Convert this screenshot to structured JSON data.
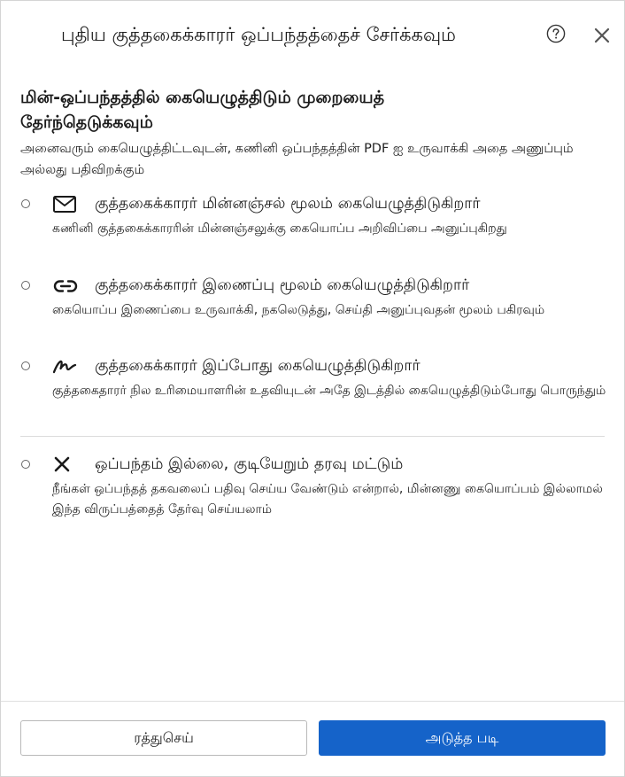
{
  "dialog": {
    "title": "புதிய குத்தகைக்காரர் ஒப்பந்தத்தைச் சேர்க்கவும்",
    "help_icon": "help-circle-icon",
    "close_icon": "close-icon"
  },
  "section": {
    "heading": "மின்-ஒப்பந்தத்தில் கையெழுத்திடும் முறையைத் தேர்ந்தெடுக்கவும்",
    "description": "அனைவரும் கையெழுத்திட்டவுடன், கணினி ஒப்பந்தத்தின் PDF ஐ உருவாக்கி அதை அணுப்பும் அல்லது பதிவிறக்கும்"
  },
  "options": [
    {
      "icon": "envelope-icon",
      "title": "குத்தகைக்காரர் மின்னஞ்சல் மூலம் கையெழுத்திடுகிறார்",
      "description": "கணினி குத்தகைக்காரரின் மின்னஞ்சலுக்கு கையொப்ப அறிவிப்பை அனுப்புகிறது"
    },
    {
      "icon": "link-icon",
      "title": "குத்தகைக்காரர் இணைப்பு மூலம் கையெழுத்திடுகிறார்",
      "description": "கையொப்ப இணைப்பை உருவாக்கி, நகலெடுத்து, செய்தி அனுப்புவதன் மூலம் பகிரவும்"
    },
    {
      "icon": "signature-icon",
      "title": "குத்தகைக்காரர் இப்போது கையெழுத்திடுகிறார்",
      "description": "குத்தகைதாரர் நில உரிமையாளரின் உதவியுடன் அதே இடத்தில் கையெழுத்திடும்போது பொருந்தும்"
    },
    {
      "icon": "x-icon",
      "title": "ஒப்பந்தம் இல்லை, குடியேறும் தரவு மட்டும்",
      "description": "நீங்கள் ஒப்பந்தத் தகவலைப் பதிவு செய்ய வேண்டும் என்றால், மின்னணு கையொப்பம் இல்லாமல் இந்த விருப்பத்தைத் தேர்வு செய்யலாம்"
    }
  ],
  "footer": {
    "cancel_label": "ரத்துசெய்",
    "next_label": "அடுத்த படி"
  },
  "colors": {
    "primary": "#1563c9",
    "border": "#d4d4d4"
  }
}
